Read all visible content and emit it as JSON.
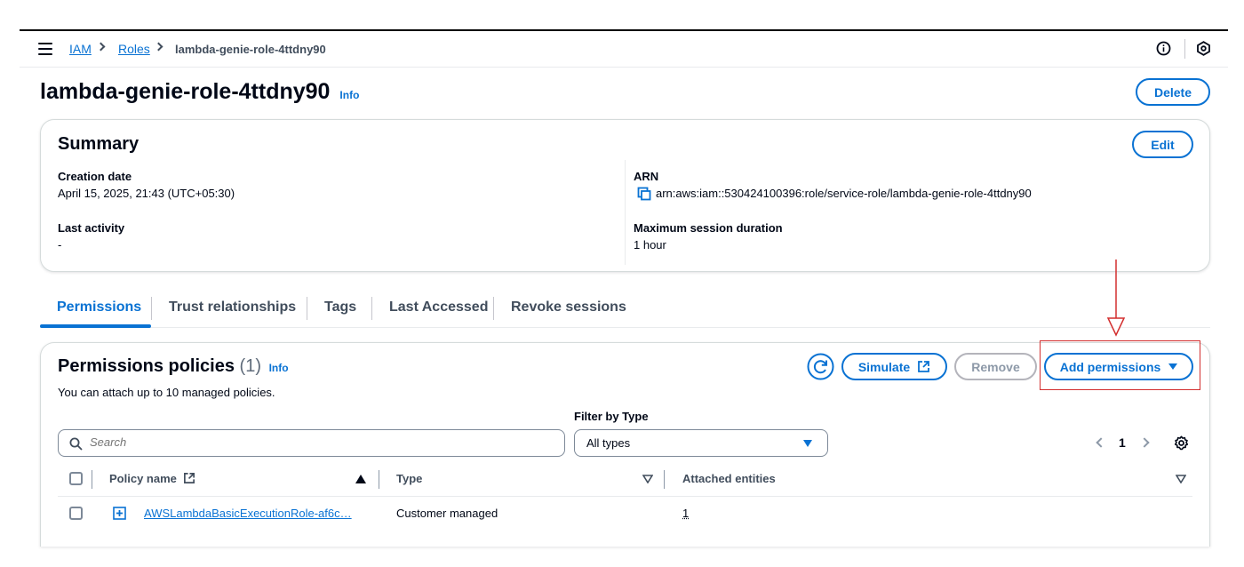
{
  "breadcrumbs": [
    {
      "label": "IAM"
    },
    {
      "label": "Roles"
    },
    {
      "label": "lambda-genie-role-4ttdny90"
    }
  ],
  "page": {
    "title": "lambda-genie-role-4ttdny90",
    "info_label": "Info",
    "delete_label": "Delete"
  },
  "summary": {
    "title": "Summary",
    "edit_label": "Edit",
    "creation_date_label": "Creation date",
    "creation_date_value": "April 15, 2025, 21:43 (UTC+05:30)",
    "last_activity_label": "Last activity",
    "last_activity_value": "-",
    "arn_label": "ARN",
    "arn_value": "arn:aws:iam::530424100396:role/service-role/lambda-genie-role-4ttdny90",
    "max_session_label": "Maximum session duration",
    "max_session_value": "1 hour"
  },
  "tabs": [
    {
      "label": "Permissions",
      "active": true
    },
    {
      "label": "Trust relationships"
    },
    {
      "label": "Tags"
    },
    {
      "label": "Last Accessed"
    },
    {
      "label": "Revoke sessions"
    }
  ],
  "permissions": {
    "title": "Permissions policies",
    "count": "(1)",
    "info_label": "Info",
    "description": "You can attach up to 10 managed policies.",
    "simulate_label": "Simulate",
    "remove_label": "Remove",
    "add_permissions_label": "Add permissions",
    "filter_label": "Filter by Type",
    "filter_value": "All types",
    "search_placeholder": "Search",
    "page_number": "1",
    "columns": {
      "policy_name": "Policy name",
      "type": "Type",
      "attached": "Attached entities"
    },
    "rows": [
      {
        "policy_name": "AWSLambdaBasicExecutionRole-af6c…",
        "type": "Customer managed",
        "attached": "1"
      }
    ]
  },
  "colors": {
    "accent": "#0972d3",
    "text": "#000716",
    "annotation": "#d32f2f"
  },
  "icons": [
    "menu-icon",
    "info-circle-icon",
    "settings-hex-icon",
    "copy-icon",
    "refresh-icon",
    "external-link-icon",
    "caret-down-icon",
    "search-icon",
    "chevron-left-icon",
    "chevron-right-icon",
    "gear-icon",
    "sort-up-icon",
    "sort-down-icon",
    "expand-icon"
  ]
}
